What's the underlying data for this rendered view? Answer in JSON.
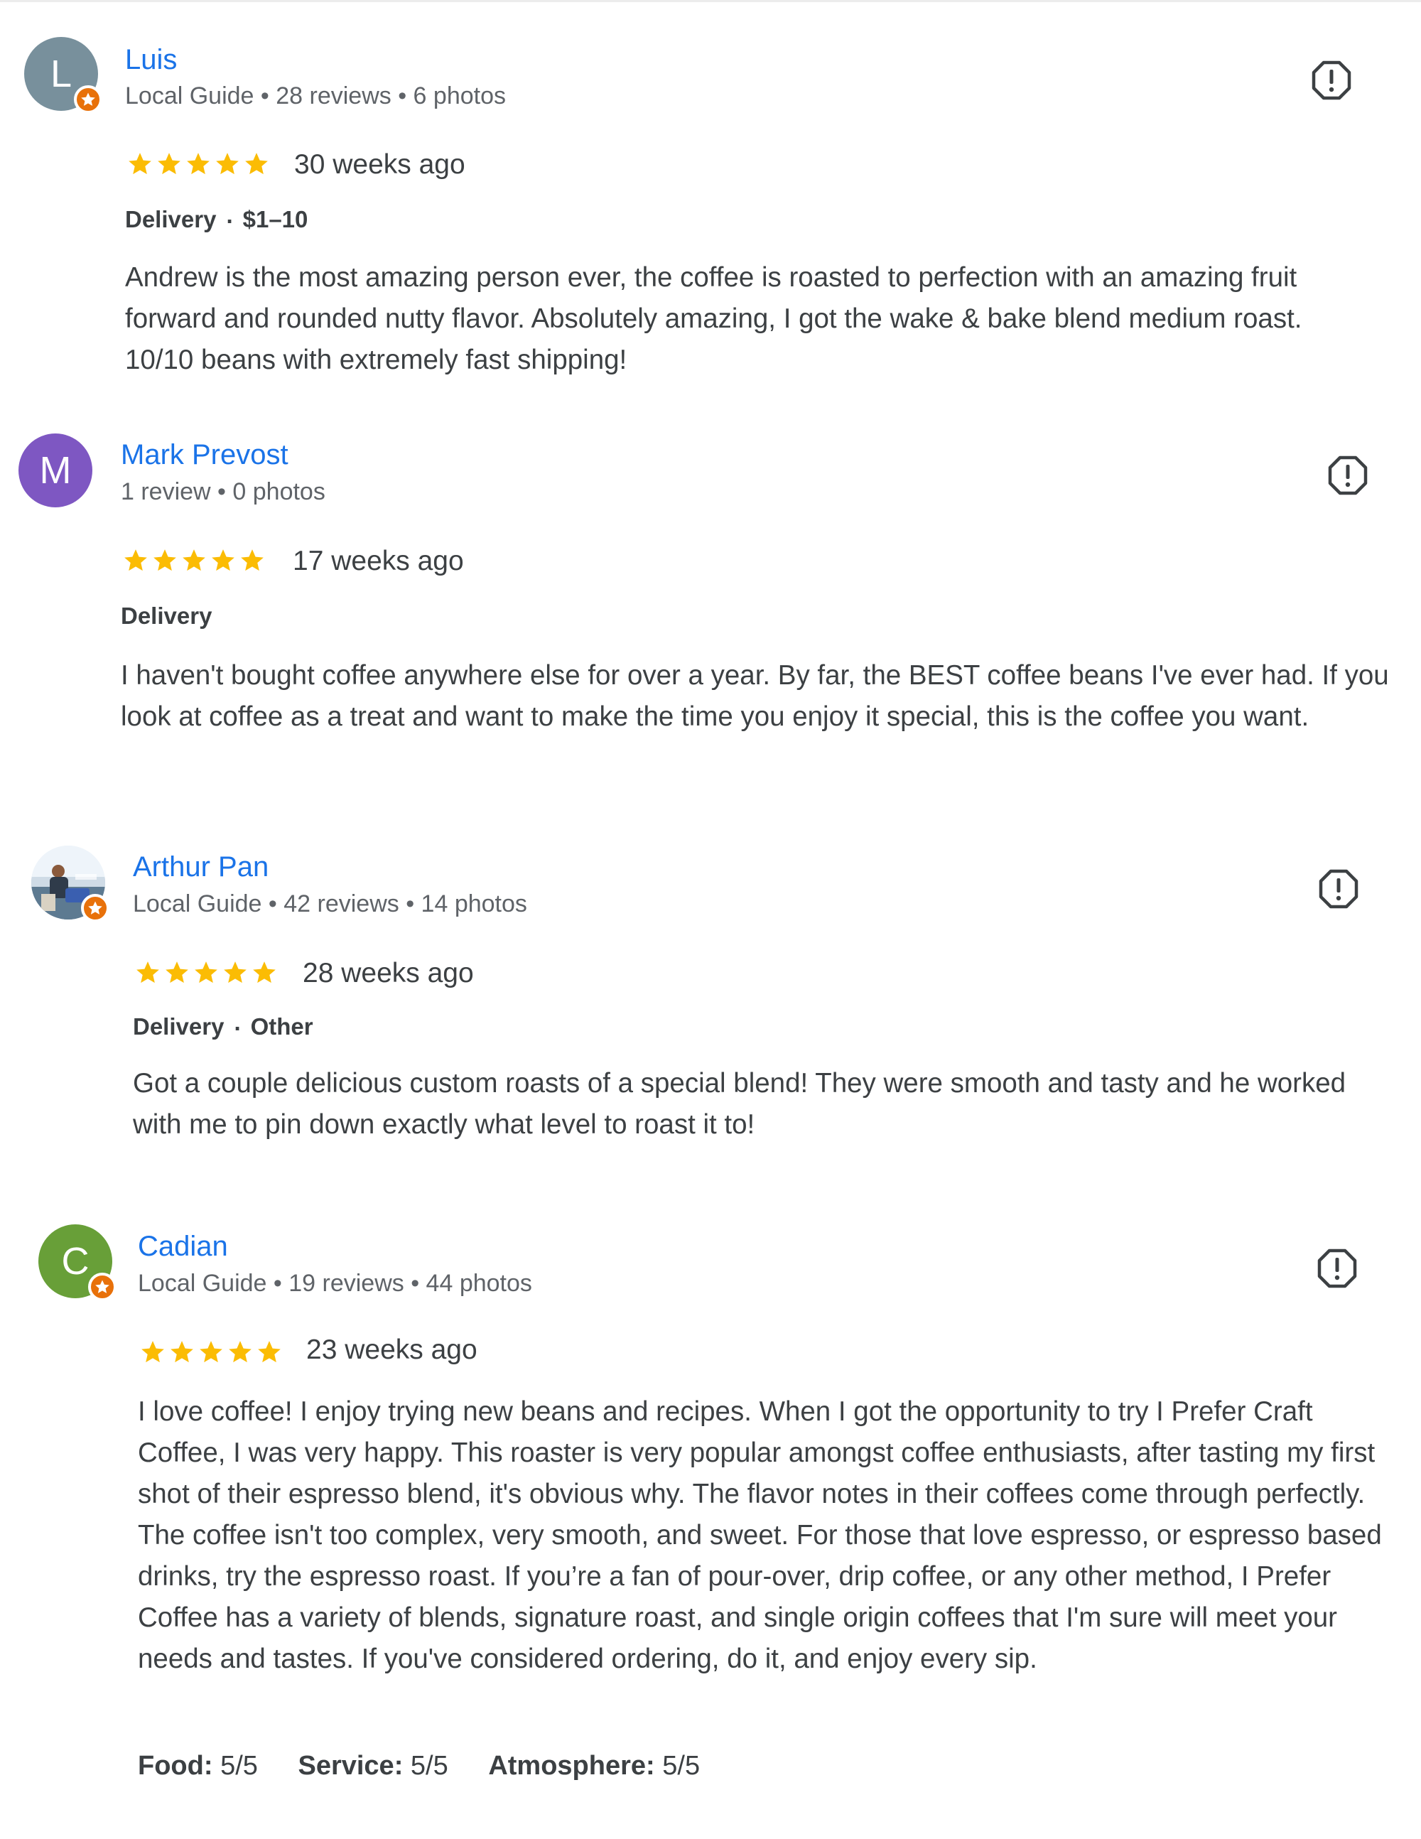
{
  "reviews": [
    {
      "name": "Luis",
      "avatar_letter": "L",
      "avatar_color": "#78909c",
      "local_guide_badge": true,
      "meta": "Local Guide • 28 reviews • 6 photos",
      "rating": 5,
      "date": "30 weeks ago",
      "tags": [
        "Delivery",
        "$1–10"
      ],
      "text": "Andrew is the most amazing person ever, the coffee is roasted to perfection with an amazing fruit forward and rounded nutty flavor. Absolutely amazing, I got the wake & bake blend medium roast. 10/10 beans with extremely fast shipping!"
    },
    {
      "name": "Mark Prevost",
      "avatar_letter": "M",
      "avatar_color": "#7e57c2",
      "local_guide_badge": false,
      "meta": "1 review • 0 photos",
      "rating": 5,
      "date": "17 weeks ago",
      "tags": [
        "Delivery"
      ],
      "text": "I haven't bought coffee anywhere else for over a year. By far, the BEST coffee beans I've ever had. If you look at coffee as a treat and want to make the time you enjoy it special, this is the coffee you want."
    },
    {
      "name": "Arthur Pan",
      "avatar_letter": "",
      "avatar_color": "#9fb4c6",
      "local_guide_badge": true,
      "meta": "Local Guide • 42 reviews • 14 photos",
      "rating": 5,
      "date": "28 weeks ago",
      "tags": [
        "Delivery",
        "Other"
      ],
      "text": "Got a couple delicious custom roasts of a special blend! They were smooth and tasty and he worked with me to pin down exactly what level to roast it to!"
    },
    {
      "name": "Cadian",
      "avatar_letter": "C",
      "avatar_color": "#689f38",
      "local_guide_badge": true,
      "meta": "Local Guide • 19 reviews • 44 photos",
      "rating": 5,
      "date": "23 weeks ago",
      "tags": [],
      "text": "I love coffee! I enjoy trying new beans and recipes. When I got the opportunity to try I Prefer Craft Coffee, I was very happy. This roaster is very popular amongst coffee enthusiasts, after tasting my first shot of their espresso blend, it's obvious why. The flavor notes in their coffees come through perfectly. The coffee isn't too complex, very smooth, and sweet. For those that love espresso, or espresso based drinks, try the espresso roast. If you’re a fan of pour-over, drip coffee, or any other method, I Prefer Coffee has a variety of blends, signature roast, and single origin coffees that I'm sure will meet your needs and tastes. If you've considered ordering, do it, and enjoy every sip.",
      "attributes": [
        {
          "label": "Food:",
          "value": "5/5"
        },
        {
          "label": "Service:",
          "value": "5/5"
        },
        {
          "label": "Atmosphere:",
          "value": "5/5"
        }
      ]
    }
  ],
  "icons": {
    "report": "report-flag-icon",
    "star": "star-icon",
    "local_guide": "local-guide-star-icon"
  },
  "colors": {
    "name_link": "#1a73e8",
    "star": "#fbbc04",
    "badge": "#e8710a",
    "meta_text": "#5f6368",
    "body_text": "#3c4043"
  }
}
